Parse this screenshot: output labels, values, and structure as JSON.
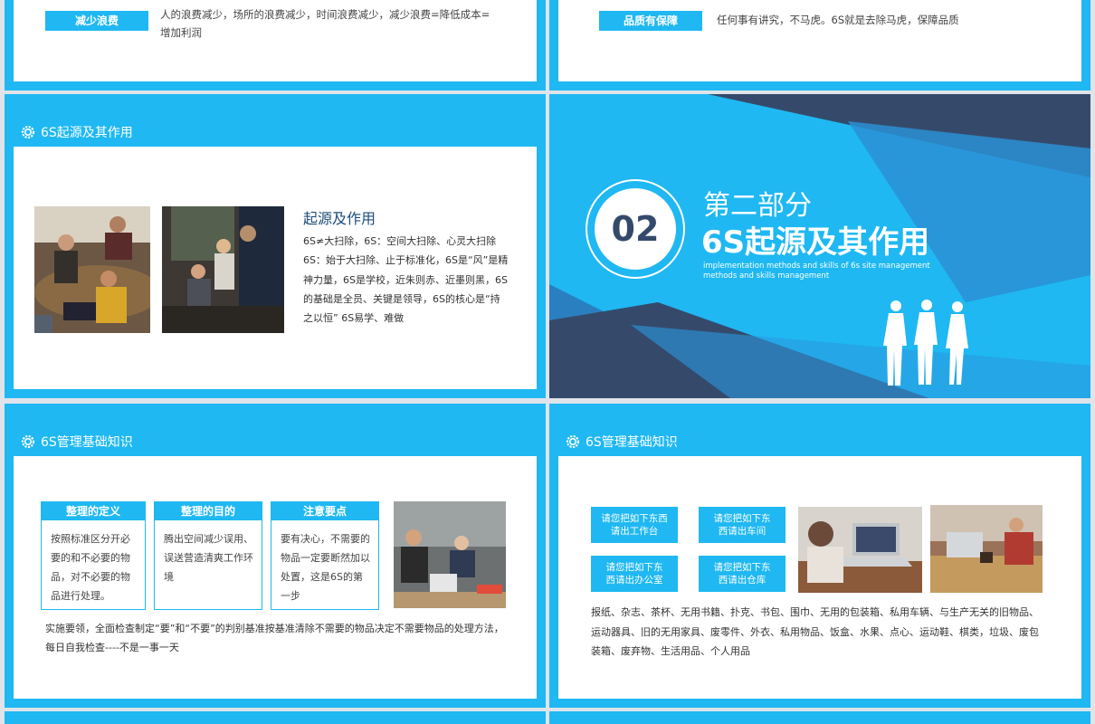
{
  "slide_top_left": {
    "tag": "减少浪费",
    "text": "人的浪费减少，场所的浪费减少，时间浪费减少，减少浪费=降低成本=增加利润"
  },
  "slide_top_right": {
    "tag": "品质有保障",
    "text": "任何事有讲究，不马虎。6S就是去除马虎，保障品质"
  },
  "slide_origin": {
    "header": "6S起源及其作用",
    "title": "起源及作用",
    "body": "6S≠大扫除，6S：空间大扫除、心灵大扫除6S：始于大扫除、止于标准化，6S是“风”是精神力量，6S是学校，近朱则赤、近墨则黑，6S的基础是全员、关键是领导，6S的核心是“持之以恒” 6S易学、难做"
  },
  "slide_section": {
    "number": "02",
    "part": "第二部分",
    "title": "6S起源及其作用",
    "sub1": "implementation methods and skills of 6s site management",
    "sub2": "methods and skills management",
    "colors": {
      "dark": "#354a6b",
      "mid": "#2a7fc0",
      "light": "#1fb8f2"
    }
  },
  "slide_basics_left": {
    "header": "6S管理基础知识",
    "boxes": [
      {
        "title": "整理的定义",
        "body": "按照标准区分开必要的和不必要的物品，对不必要的物品进行处理。"
      },
      {
        "title": "整理的目的",
        "body": "腾出空间减少误用、误送营造清爽工作环境"
      },
      {
        "title": "注意要点",
        "body": "要有决心，不需要的物品一定要断然加以处置，这是6S的第一步"
      }
    ],
    "footer": "实施要领，全面检查制定“要”和“不要”的判别基准按基准清除不需要的物品决定不需要物品的处理方法，每日自我检查----不是一事一天"
  },
  "slide_basics_right": {
    "header": "6S管理基础知识",
    "buttons": [
      {
        "l1": "请您把如下东西",
        "l2": "请出工作台"
      },
      {
        "l1": "请您把如下东",
        "l2": "西请出车间"
      },
      {
        "l1": "请您把如下东",
        "l2": "西请出办公室"
      },
      {
        "l1": "请您把如下东",
        "l2": "西请出仓库"
      }
    ],
    "body": "报纸、杂志、茶杯、无用书籍、扑克、书包、围巾、无用的包装箱、私用车辆、与生产无关的旧物品、运动器具、旧的无用家具、废零件、外衣、私用物品、饭盒、水果、点心、运动鞋、棋类，垃圾、废包装箱、废弃物、生活用品、个人用品"
  }
}
